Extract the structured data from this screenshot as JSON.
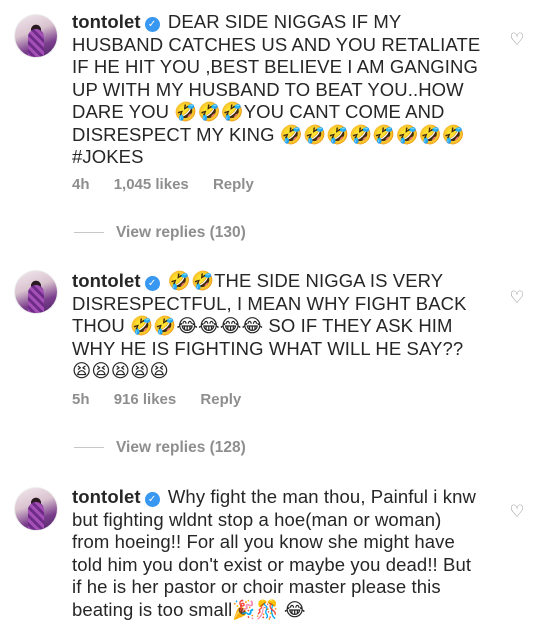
{
  "comments": [
    {
      "username": "tontolet",
      "text": "DEAR SIDE NIGGAS IF MY HUSBAND CATCHES US AND YOU RETALIATE IF HE HIT YOU ,BEST BELIEVE I AM GANGING UP WITH MY HUSBAND TO BEAT YOU..HOW DARE YOU 🤣🤣🤣YOU CANT COME AND DISRESPECT MY KING 🤣🤣🤣🤣🤣🤣🤣🤣 #JOKES",
      "time": "4h",
      "likes": "1,045 likes",
      "reply": "Reply",
      "view_replies": "View replies (130)"
    },
    {
      "username": "tontolet",
      "text": "🤣🤣THE SIDE NIGGA IS VERY DISRESPECTFUL, I MEAN WHY FIGHT BACK THOU 🤣🤣😂😂😂😂 SO IF THEY ASK HIM WHY HE IS FIGHTING WHAT WILL HE SAY?? 😫😫😫😫😫",
      "time": "5h",
      "likes": "916 likes",
      "reply": "Reply",
      "view_replies": "View replies (128)"
    },
    {
      "username": "tontolet",
      "text": "Why fight the man thou, Painful i knw but fighting wldnt stop a hoe(man or woman) from hoeing!! For all you know she might have told him you don't exist or maybe you dead!! But if he is her pastor or choir master please  this beating is too small🎉🎊 😂"
    }
  ],
  "icons": {
    "verified": "verified-badge-icon",
    "like": "heart-outline-icon"
  },
  "colors": {
    "verified": "#3897f0",
    "meta_text": "#8e8e8e"
  }
}
